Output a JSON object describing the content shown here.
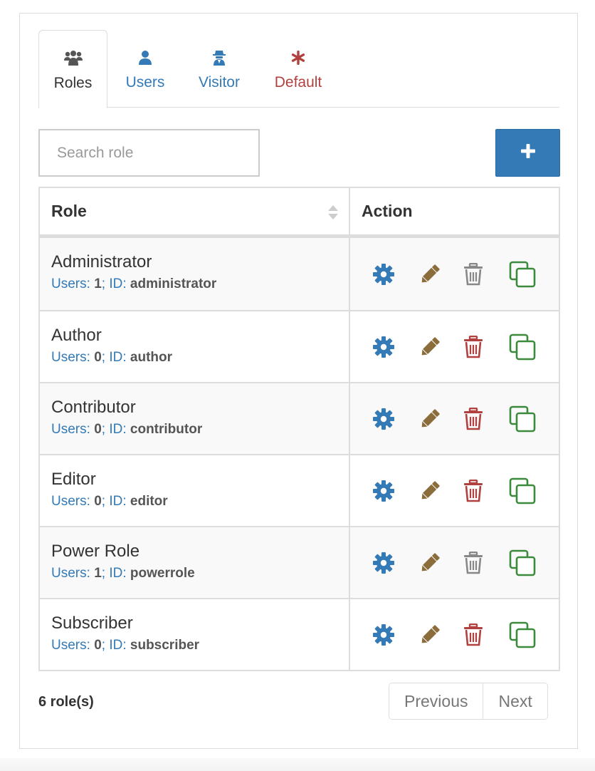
{
  "tabs": [
    {
      "label": "Roles",
      "icon": "users-group-icon",
      "active": true
    },
    {
      "label": "Users",
      "icon": "user-icon",
      "active": false
    },
    {
      "label": "Visitor",
      "icon": "user-secret-icon",
      "active": false
    },
    {
      "label": "Default",
      "icon": "asterisk-icon",
      "active": false
    }
  ],
  "search": {
    "placeholder": "Search role",
    "value": ""
  },
  "add_button": {
    "icon": "plus-icon"
  },
  "table": {
    "headers": {
      "role": "Role",
      "action": "Action"
    },
    "rows": [
      {
        "name": "Administrator",
        "users_label": "Users:",
        "users": "1",
        "id_label": "ID:",
        "id": "administrator",
        "delete_enabled": false
      },
      {
        "name": "Author",
        "users_label": "Users:",
        "users": "0",
        "id_label": "ID:",
        "id": "author",
        "delete_enabled": true
      },
      {
        "name": "Contributor",
        "users_label": "Users:",
        "users": "0",
        "id_label": "ID:",
        "id": "contributor",
        "delete_enabled": true
      },
      {
        "name": "Editor",
        "users_label": "Users:",
        "users": "0",
        "id_label": "ID:",
        "id": "editor",
        "delete_enabled": true
      },
      {
        "name": "Power Role",
        "users_label": "Users:",
        "users": "1",
        "id_label": "ID:",
        "id": "powerrole",
        "delete_enabled": false
      },
      {
        "name": "Subscriber",
        "users_label": "Users:",
        "users": "0",
        "id_label": "ID:",
        "id": "subscriber",
        "delete_enabled": true
      }
    ]
  },
  "footer": {
    "count": "6 role(s)",
    "previous": "Previous",
    "next": "Next"
  },
  "colors": {
    "primary": "#337ab7",
    "edit": "#8a6d3b",
    "danger": "#b0413e",
    "disabled": "#888888",
    "clone": "#3c8a3c"
  }
}
